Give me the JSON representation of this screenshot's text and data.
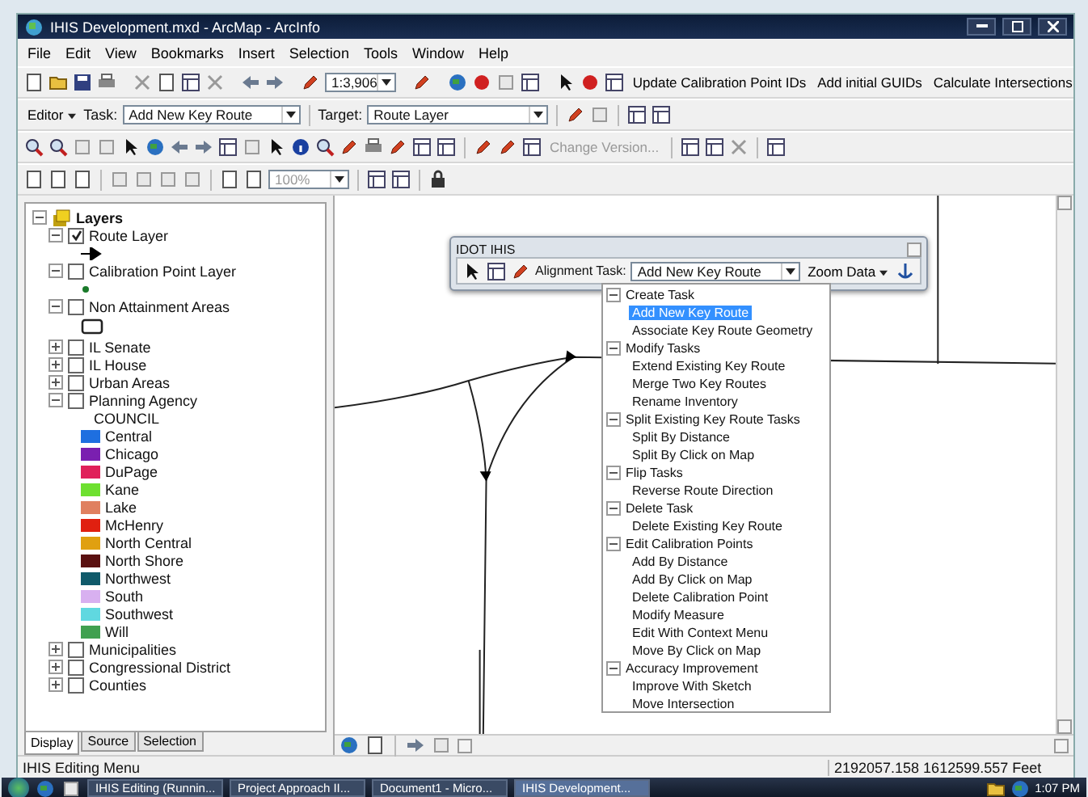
{
  "window": {
    "title": "IHIS Development.mxd - ArcMap - ArcInfo"
  },
  "menu": [
    "File",
    "Edit",
    "View",
    "Bookmarks",
    "Insert",
    "Selection",
    "Tools",
    "Window",
    "Help"
  ],
  "standard_toolbar": {
    "scale": "1:3,906",
    "buttons": [
      "Update Calibration Point IDs",
      "Add initial GUIDs",
      "Calculate Intersections"
    ]
  },
  "editor_toolbar": {
    "editor_menu": "Editor",
    "task_label": "Task:",
    "task": "Add New Key Route",
    "target_label": "Target:",
    "target": "Route Layer"
  },
  "tools_toolbar": {
    "change_version": "Change Version..."
  },
  "layout_toolbar": {
    "zoom": "100%"
  },
  "toc": {
    "root": "Layers",
    "layers": [
      {
        "name": "Route Layer",
        "checked": true,
        "expanded": true,
        "legend": {
          "kind": "arrow"
        }
      },
      {
        "name": "Calibration Point Layer",
        "checked": false,
        "expanded": true,
        "legend": {
          "kind": "point"
        }
      },
      {
        "name": "Non Attainment Areas",
        "checked": false,
        "expanded": true,
        "legend": {
          "kind": "polygon"
        }
      },
      {
        "name": "IL Senate",
        "checked": false,
        "expanded": false
      },
      {
        "name": "IL House",
        "checked": false,
        "expanded": false
      },
      {
        "name": "Urban Areas",
        "checked": false,
        "expanded": false
      },
      {
        "name": "Planning Agency",
        "checked": false,
        "expanded": true,
        "field": "COUNCIL",
        "classes": [
          {
            "label": "Central",
            "color": "#1e6fe0"
          },
          {
            "label": "Chicago",
            "color": "#7a1fb0"
          },
          {
            "label": "DuPage",
            "color": "#e0205a"
          },
          {
            "label": "Kane",
            "color": "#6ee030"
          },
          {
            "label": "Lake",
            "color": "#e08060"
          },
          {
            "label": "McHenry",
            "color": "#e02010"
          },
          {
            "label": "North Central",
            "color": "#e0a010"
          },
          {
            "label": "North Shore",
            "color": "#5a1010"
          },
          {
            "label": "Northwest",
            "color": "#105a6a"
          },
          {
            "label": "South",
            "color": "#d8b0f0"
          },
          {
            "label": "Southwest",
            "color": "#60d8e0"
          },
          {
            "label": "Will",
            "color": "#40a050"
          }
        ]
      },
      {
        "name": "Municipalities",
        "checked": false,
        "expanded": false
      },
      {
        "name": "Congressional District",
        "checked": false,
        "expanded": false
      },
      {
        "name": "Counties",
        "checked": false,
        "expanded": false
      }
    ],
    "tabs": [
      {
        "label": "Display",
        "selected": true
      },
      {
        "label": "Source",
        "selected": false
      },
      {
        "label": "Selection",
        "selected": false
      }
    ]
  },
  "ihis_toolbar": {
    "title": "IDOT IHIS",
    "task_label": "Alignment Task:",
    "task": "Add New Key Route",
    "zoom_menu": "Zoom Data"
  },
  "task_dropdown": [
    {
      "group": "Create Task",
      "expanded": true,
      "items": [
        {
          "label": "Add New Key Route",
          "selected": true
        },
        {
          "label": "Associate Key Route Geometry",
          "selected": false
        }
      ]
    },
    {
      "group": "Modify Tasks",
      "expanded": true,
      "items": [
        {
          "label": "Extend Existing Key Route",
          "selected": false
        },
        {
          "label": "Merge Two Key Routes",
          "selected": false
        },
        {
          "label": "Rename Inventory",
          "selected": false
        }
      ]
    },
    {
      "group": "Split Existing Key Route Tasks",
      "expanded": true,
      "items": [
        {
          "label": "Split By Distance",
          "selected": false
        },
        {
          "label": "Split By Click on Map",
          "selected": false
        }
      ]
    },
    {
      "group": "Flip Tasks",
      "expanded": true,
      "items": [
        {
          "label": "Reverse Route Direction",
          "selected": false
        }
      ]
    },
    {
      "group": "Delete Task",
      "expanded": true,
      "items": [
        {
          "label": "Delete Existing Key Route",
          "selected": false
        }
      ]
    },
    {
      "group": "Edit Calibration Points",
      "expanded": true,
      "items": [
        {
          "label": "Add By Distance",
          "selected": false
        },
        {
          "label": "Add By Click on Map",
          "selected": false
        },
        {
          "label": "Delete Calibration Point",
          "selected": false
        },
        {
          "label": "Modify Measure",
          "selected": false
        },
        {
          "label": "Edit With Context Menu",
          "selected": false
        },
        {
          "label": "Move By Click on Map",
          "selected": false
        }
      ]
    },
    {
      "group": "Accuracy Improvement",
      "expanded": true,
      "items": [
        {
          "label": "Improve With Sketch",
          "selected": false
        },
        {
          "label": "Move Intersection",
          "selected": false
        }
      ]
    }
  ],
  "status_bar": {
    "message": "IHIS Editing Menu",
    "coordinates": "2192057.158  1612599.557 Feet"
  },
  "taskbar": {
    "buttons": [
      {
        "label": "IHIS Editing (Runnin...",
        "selected": false
      },
      {
        "label": "Project Approach II...",
        "selected": false
      },
      {
        "label": "Document1 - Micro...",
        "selected": false
      },
      {
        "label": "IHIS Development...",
        "selected": true
      }
    ],
    "clock": "1:07 PM"
  }
}
